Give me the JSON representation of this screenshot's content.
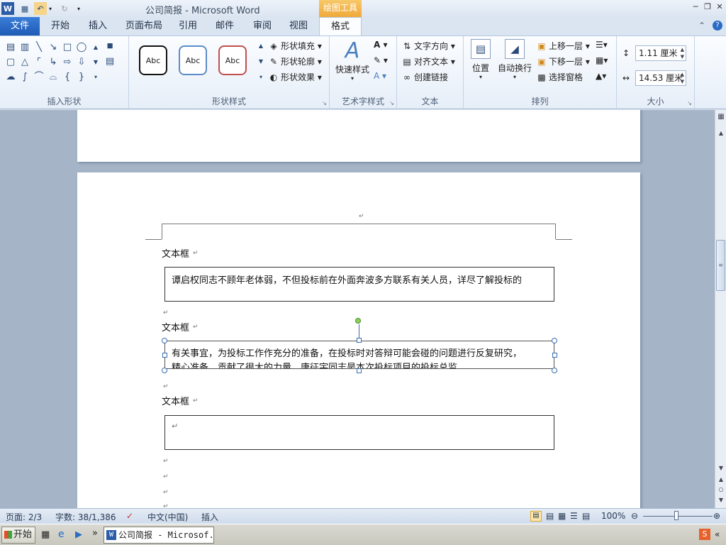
{
  "window": {
    "title": "公司简报  -  Microsoft Word",
    "context_tab_title": "绘图工具",
    "app_icon": "W"
  },
  "tabs": {
    "file": "文件",
    "items": [
      "开始",
      "插入",
      "页面布局",
      "引用",
      "邮件",
      "审阅",
      "视图"
    ],
    "active": "格式"
  },
  "ribbon": {
    "insert_shapes": {
      "caption": "插入形状"
    },
    "shape_styles": {
      "caption": "形状样式",
      "style_sample": "Abc",
      "fill": "形状填充",
      "outline": "形状轮廓",
      "effects": "形状效果"
    },
    "wordart": {
      "caption": "艺术字样式",
      "quick_styles": "快速样式"
    },
    "text": {
      "caption": "文本",
      "direction": "文字方向",
      "align": "对齐文本",
      "link": "创建链接"
    },
    "arrange": {
      "caption": "排列",
      "position": "位置",
      "wrap": "自动换行",
      "bring_forward": "上移一层",
      "send_backward": "下移一层",
      "selection_pane": "选择窗格"
    },
    "size": {
      "caption": "大小",
      "height": "1.11 厘米",
      "width": "14.53 厘米"
    }
  },
  "document": {
    "paragraph_mark": "↵",
    "label": "文本框",
    "textbox1_text": "谭启权同志不顾年老体弱，不但投标前在外面奔波多方联系有关人员，详尽了解投标的",
    "textbox2_line1": "有关事宜，为投标工作作充分的准备，在投标时对答辩可能会碰的问题进行反复研究，",
    "textbox2_line2": "精心准备，贡献了很大的力量。唐征宇同志是本次投标项目的投标总监，"
  },
  "status": {
    "page": "页面: 2/3",
    "words": "字数: 38/1,386",
    "language": "中文(中国)",
    "mode": "插入",
    "zoom": "100%"
  },
  "taskbar": {
    "start": "开始",
    "word_task": "公司简报 - Microsof..."
  },
  "colors": {
    "file_tab": "#2a6cc4",
    "context_tab": "#f0a93a",
    "page_background": "#a5b4c6"
  }
}
